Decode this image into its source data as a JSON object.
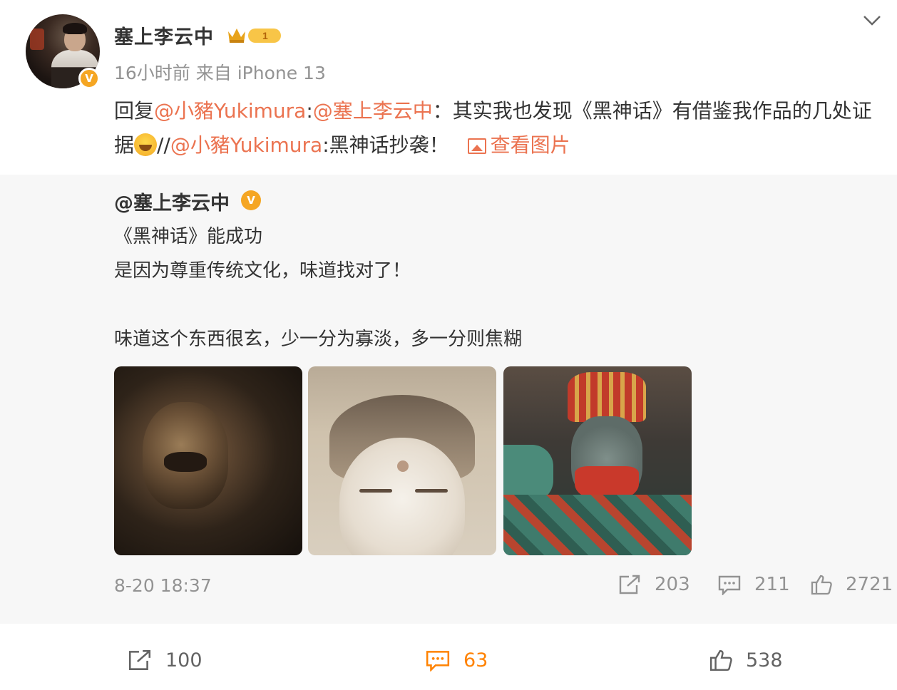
{
  "post": {
    "username": "塞上李云中",
    "vip_level": "1",
    "meta": "16小时前  来自 iPhone 13",
    "reply": {
      "prefix": "回复",
      "mention1": "@小豬Yukimura",
      "colon1": ":",
      "mention2": "@塞上李云中",
      "text1": "：其实我也发现《黑神话》有借鉴我作品的几处证据",
      "sep": "//",
      "mention3": "@小豬Yukimura",
      "text2": ":黑神话抄袭！",
      "view_pic": "查看图片"
    }
  },
  "retweet": {
    "user": "@塞上李云中",
    "line1": "《黑神话》能成功",
    "line2": "是因为尊重传统文化，味道找对了！",
    "line3": "味道这个东西很玄，少一分为寡淡，多一分则焦糊",
    "time": "8-20 18:37",
    "repost_count": "203",
    "comment_count": "211",
    "like_count": "2721"
  },
  "bottom_bar": {
    "repost_count": "100",
    "comment_count": "63",
    "like_count": "538"
  },
  "colors": {
    "link": "#eb7350",
    "verified_badge": "#f5a623",
    "active_action": "#ff8200",
    "retweet_bg": "#f7f7f7"
  }
}
